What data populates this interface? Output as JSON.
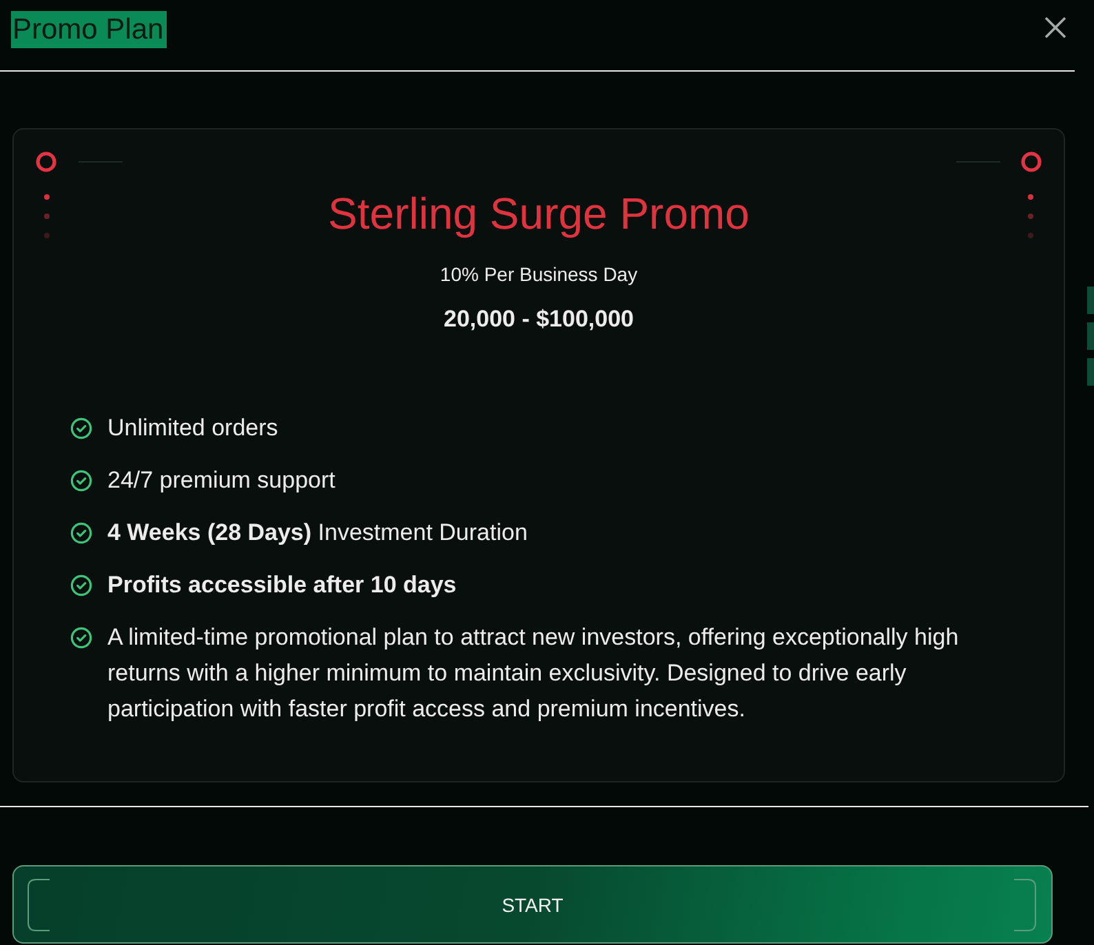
{
  "dialog": {
    "title": "Promo Plan",
    "title_highlighted": true
  },
  "plan": {
    "name": "Sterling Surge Promo",
    "rate": "10% Per Business Day",
    "range": "20,000 - $100,000",
    "features": [
      {
        "text": "Unlimited orders",
        "bold": false
      },
      {
        "text": "24/7 premium support",
        "bold": false
      },
      {
        "text": "**4 Weeks (28 Days)** Investment Duration",
        "bold": false
      },
      {
        "text": "Profits accessible after 10 days",
        "bold": true
      },
      {
        "text": "A limited-time promotional plan to attract new investors, offering exceptionally high returns with a higher minimum to maintain exclusivity. Designed to drive early participation with faster profit access and premium incentives.",
        "bold": false
      }
    ]
  },
  "button": {
    "label": "START"
  }
}
